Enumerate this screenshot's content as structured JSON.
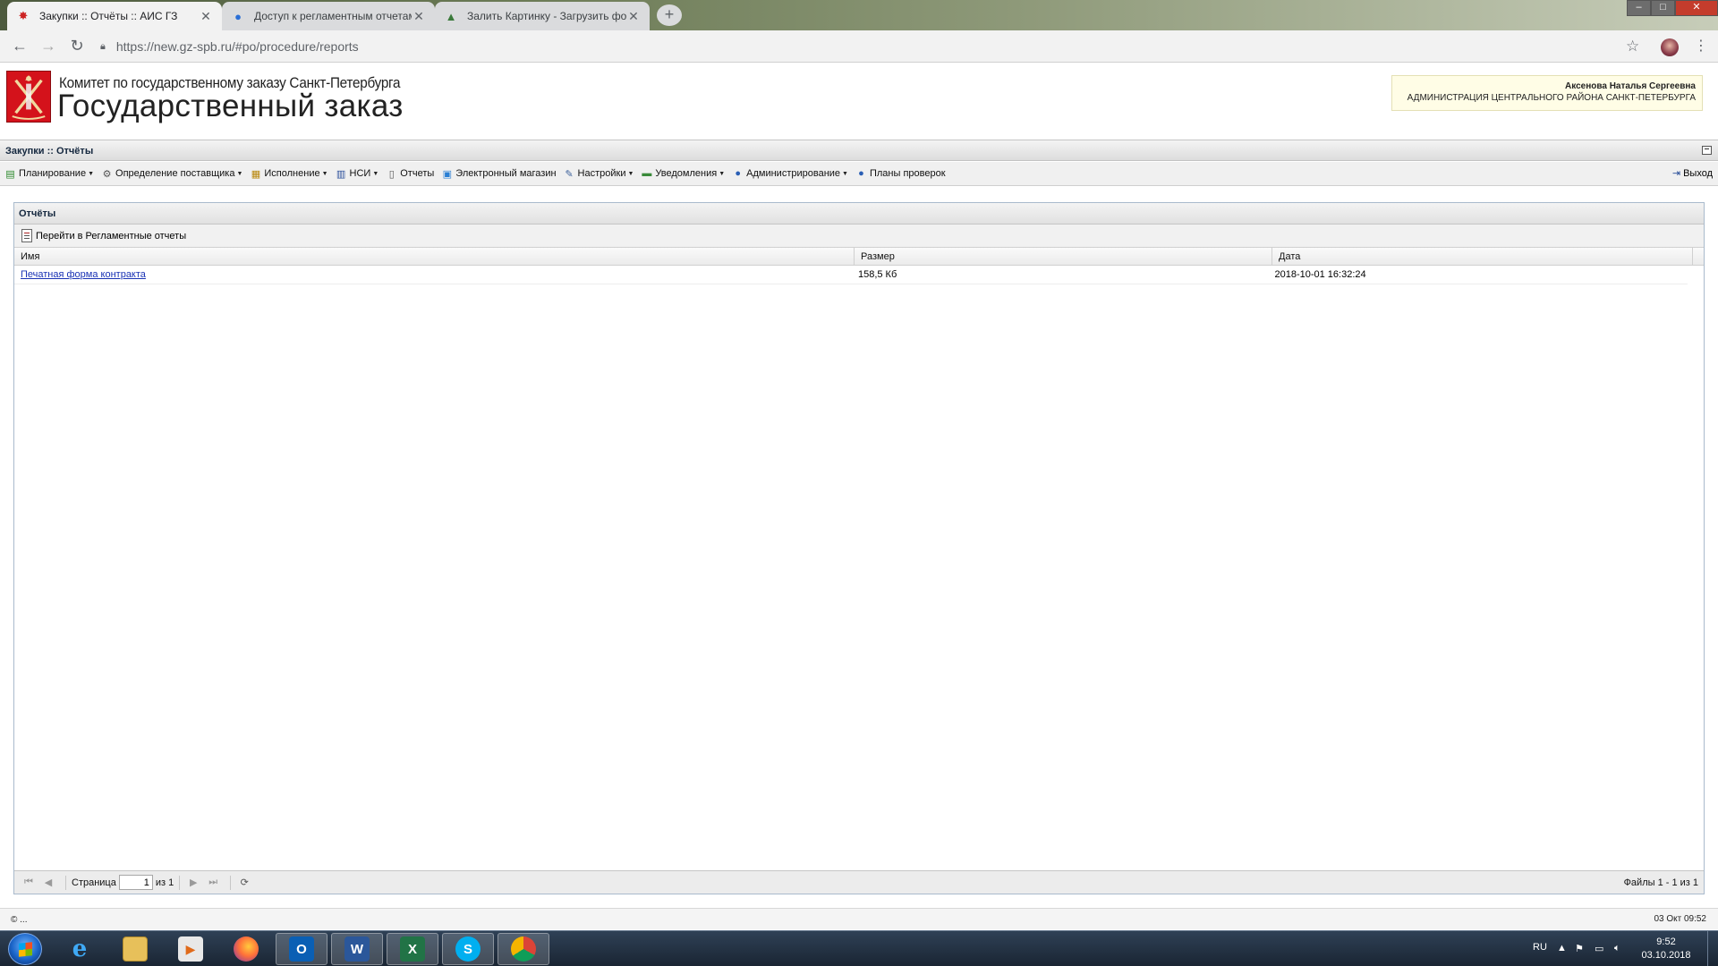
{
  "browser": {
    "tabs": [
      {
        "title": "Закупки :: Отчёты :: АИС ГЗ",
        "icon": "spb-emblem-icon",
        "active": true
      },
      {
        "title": "Доступ к регламентным отчетам",
        "icon": "globe-icon",
        "active": false
      },
      {
        "title": "Залить Картинку - Загрузить фото",
        "icon": "image-icon",
        "active": false
      }
    ],
    "url": "https://new.gz-spb.ru/#po/procedure/reports"
  },
  "header": {
    "org_name": "Комитет по государственному заказу Санкт-Петербурга",
    "brand": "Государственный заказ",
    "user_name": "Аксенова Наталья Сергеевна",
    "user_org": "АДМИНИСТРАЦИЯ ЦЕНТРАЛЬНОГО РАЙОНА САНКТ-ПЕТЕРБУРГА"
  },
  "panel": {
    "title": "Закупки :: Отчёты"
  },
  "menu": {
    "items": [
      {
        "label": "Планирование",
        "icon": "planning-icon",
        "dropdown": true
      },
      {
        "label": "Определение поставщика",
        "icon": "gears-icon",
        "dropdown": true
      },
      {
        "label": "Исполнение",
        "icon": "execution-icon",
        "dropdown": true
      },
      {
        "label": "НСИ",
        "icon": "book-icon",
        "dropdown": true
      },
      {
        "label": "Отчеты",
        "icon": "report-icon",
        "dropdown": false
      },
      {
        "label": "Электронный магазин",
        "icon": "cart-icon",
        "dropdown": false
      },
      {
        "label": "Настройки",
        "icon": "wrench-icon",
        "dropdown": true
      },
      {
        "label": "Уведомления",
        "icon": "notification-icon",
        "dropdown": true
      },
      {
        "label": "Администрирование",
        "icon": "user-icon",
        "dropdown": true
      },
      {
        "label": "Планы проверок",
        "icon": "user-icon",
        "dropdown": false
      }
    ],
    "logout": "Выход"
  },
  "reports": {
    "window_title": "Отчёты",
    "goto_label": "Перейти в Регламентные отчеты",
    "columns": [
      "Имя",
      "Размер",
      "Дата"
    ],
    "rows": [
      {
        "name": "Печатная форма контракта",
        "size": "158,5 Кб",
        "date": "2018-10-01 16:32:24"
      }
    ],
    "pager": {
      "page_label": "Страница",
      "page": "1",
      "of_label": "из 1",
      "total": "Файлы 1 - 1 из 1"
    }
  },
  "status": {
    "left": "© ...",
    "right": "03 Окт 09:52"
  },
  "taskbar": {
    "lang": "RU",
    "time": "9:52",
    "date": "03.10.2018"
  },
  "colors": {
    "link": "#1a33b5",
    "emblem_red": "#d4121b",
    "userbox_bg": "#fffde6"
  }
}
